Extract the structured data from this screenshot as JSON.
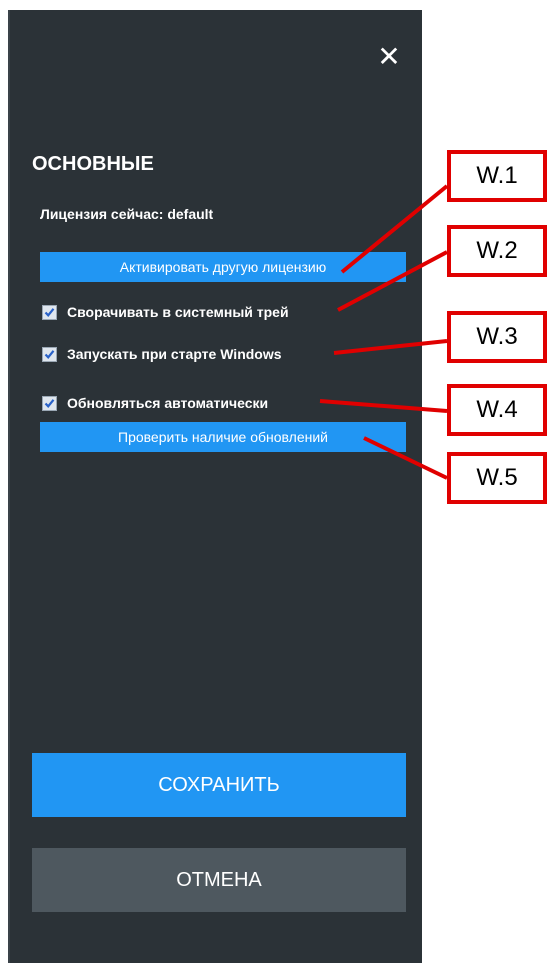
{
  "panel": {
    "close_icon_glyph": "✕",
    "section_title": "ОСНОВНЫЕ",
    "license_text": "Лицензия сейчас: default",
    "activate_button": "Активировать другую лицензию",
    "options": [
      {
        "label": "Сворачивать в системный трей",
        "checked": true
      },
      {
        "label": "Запускать при старте Windows",
        "checked": true
      },
      {
        "label": "Обновляться автоматически",
        "checked": true
      }
    ],
    "check_updates_button": "Проверить наличие обновлений",
    "save_button": "СОХРАНИТЬ",
    "cancel_button": "ОТМЕНА"
  },
  "annotations": {
    "labels": [
      "W.1",
      "W.2",
      "W.3",
      "W.4",
      "W.5"
    ]
  },
  "colors": {
    "panel_bg": "#2b3237",
    "accent": "#2196f3",
    "cancel_bg": "#4e585f",
    "annotation_red": "#e00000"
  }
}
